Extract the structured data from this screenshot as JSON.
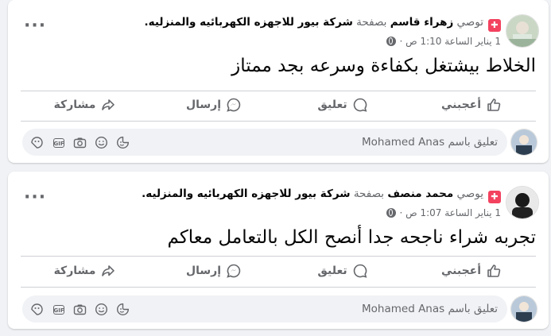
{
  "posts": [
    {
      "recommends_label": "توصي",
      "author": "زهراء قاسم",
      "on_page_label": "بصفحة",
      "page_name": "شركة بيور للاجهزه الكهربائيه والمنزليه.",
      "time": "1 يناير الساعة 1:10 ص ·",
      "text": "الخلاط بيشتغل بكفاءة وسرعه بجد ممتاز",
      "actions": {
        "like": "أعجبني",
        "comment": "تعليق",
        "send": "إرسال",
        "share": "مشاركة"
      },
      "comment_placeholder": "تعليق باسم Mohamed Anas"
    },
    {
      "recommends_label": "يوصي",
      "author": "محمد منصف",
      "on_page_label": "بصفحة",
      "page_name": "شركة بيور للاجهزه الكهربائيه والمنزليه.",
      "time": "1 يناير الساعة 1:07 ص ·",
      "text": "تجربه شراء ناجحه جدا أنصح الكل بالتعامل معاكم",
      "actions": {
        "like": "أعجبني",
        "comment": "تعليق",
        "send": "إرسال",
        "share": "مشاركة"
      },
      "comment_placeholder": "تعليق باسم Mohamed Anas"
    }
  ],
  "colors": {
    "recommend_badge": "#f3425f",
    "secondary_text": "#65676b",
    "background": "#f0f2f5"
  },
  "icons": [
    "recommend-icon",
    "globe-icon",
    "more-options-icon",
    "like-icon",
    "comment-icon",
    "send-icon",
    "share-icon",
    "sticker-icon",
    "gif-icon",
    "camera-icon",
    "emoji-icon",
    "avatar-sticker-icon"
  ]
}
